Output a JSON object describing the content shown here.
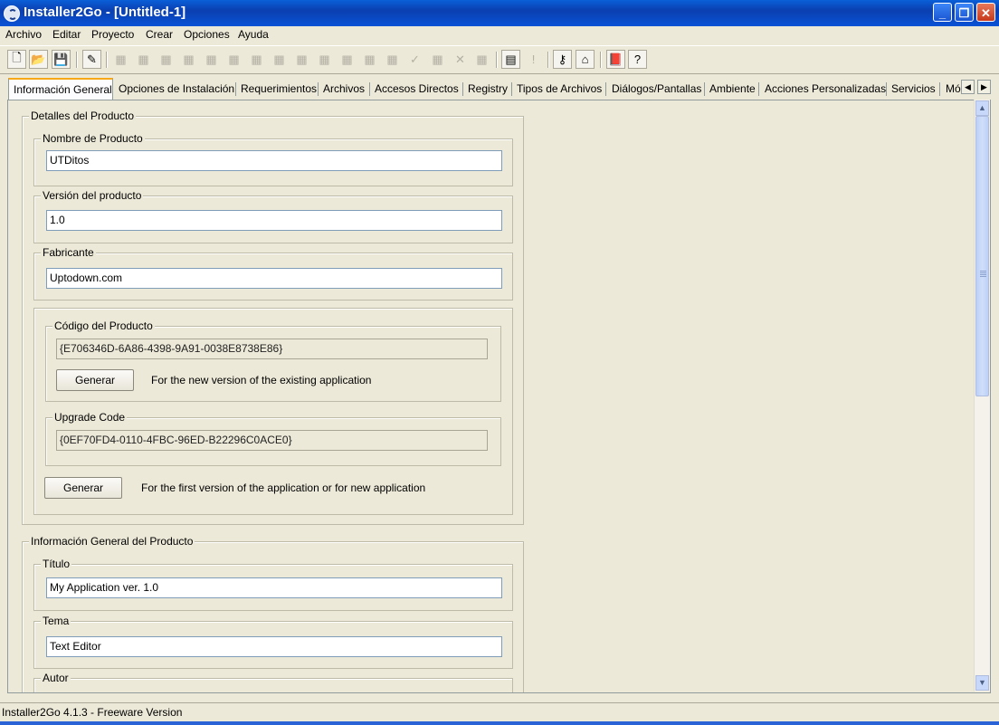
{
  "window": {
    "title": "Installer2Go - [Untitled-1]",
    "min_glyph": "_",
    "restore_glyph": "❐",
    "close_glyph": "✕"
  },
  "menu": [
    "Archivo",
    "Editar",
    "Proyecto",
    "Crear",
    "Opciones",
    "Ayuda"
  ],
  "toolbar_glyphs": {
    "new": "🗋",
    "open": "📂",
    "save": "💾",
    "wand": "✎",
    "disabled": "▦",
    "check": "✓",
    "cross": "✕",
    "build": "▤",
    "run": "!",
    "key": "⚷",
    "home": "⌂",
    "book": "📕",
    "help": "?"
  },
  "tabs": [
    "Información General",
    "Opciones de Instalación",
    "Requerimientos",
    "Archivos",
    "Accesos Directos",
    "Registry",
    "Tipos de Archivos",
    "Diálogos/Pantallas",
    "Ambiente",
    "Acciones Personalizadas",
    "Servicios",
    "Mó"
  ],
  "tab_scroll": {
    "left": "◀",
    "right": "▶"
  },
  "scrollbar": {
    "up": "▲",
    "down": "▼"
  },
  "product_details": {
    "title": "Detalles del Producto",
    "name_label": "Nombre de Producto",
    "name_value": "UTDitos",
    "version_label": "Versión del producto",
    "version_value": "1.0",
    "manufacturer_label": "Fabricante",
    "manufacturer_value": "Uptodown.com",
    "product_code_label": "Código del Producto",
    "product_code_value": "{E706346D-6A86-4398-9A91-0038E8738E86}",
    "generate_label": "Generar",
    "product_code_hint": "For the new version of the existing application",
    "upgrade_code_label": "Upgrade Code",
    "upgrade_code_value": "{0EF70FD4-0110-4FBC-96ED-B22296C0ACE0}",
    "upgrade_generate_label": "Generar",
    "upgrade_hint": "For the first version of the application or for new application"
  },
  "general_info": {
    "title": "Información General del Producto",
    "title_label": "Título",
    "title_value": "My Application ver. 1.0",
    "subject_label": "Tema",
    "subject_value": "Text Editor",
    "author_label": "Autor"
  },
  "status": "Installer2Go 4.1.3 - Freeware Version",
  "colors": {
    "titlebar": "#0a3fb0",
    "active_tab_accent": "#f7a818",
    "window_bg": "#ece9d8"
  }
}
